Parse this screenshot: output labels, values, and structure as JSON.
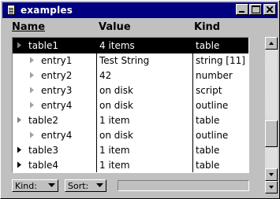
{
  "window": {
    "title": "examples"
  },
  "columns": {
    "name": "Name",
    "value": "Value",
    "kind": "Kind"
  },
  "rows": [
    {
      "name": "table1",
      "value": "4 items",
      "kind": "table",
      "indent": 0,
      "state": "expanded",
      "selected": true
    },
    {
      "name": "entry1",
      "value": "Test String",
      "kind": "string [11]",
      "indent": 1,
      "state": "leaf",
      "selected": false
    },
    {
      "name": "entry2",
      "value": "42",
      "kind": "number",
      "indent": 1,
      "state": "leaf",
      "selected": false
    },
    {
      "name": "entry3",
      "value": "on disk",
      "kind": "script",
      "indent": 1,
      "state": "leaf",
      "selected": false
    },
    {
      "name": "entry4",
      "value": "on disk",
      "kind": "outline",
      "indent": 1,
      "state": "leaf",
      "selected": false
    },
    {
      "name": "table2",
      "value": "1 item",
      "kind": "table",
      "indent": 0,
      "state": "expanded",
      "selected": false
    },
    {
      "name": "entry4",
      "value": "on disk",
      "kind": "outline",
      "indent": 1,
      "state": "leaf",
      "selected": false
    },
    {
      "name": "table3",
      "value": "1 item",
      "kind": "table",
      "indent": 0,
      "state": "collapsed",
      "selected": false
    },
    {
      "name": "table4",
      "value": "1 item",
      "kind": "table",
      "indent": 0,
      "state": "collapsed",
      "selected": false
    }
  ],
  "footer": {
    "kind_dropdown": "Kind:",
    "sort_dropdown": "Sort:"
  },
  "scrollbar": {
    "position": 0.77
  }
}
